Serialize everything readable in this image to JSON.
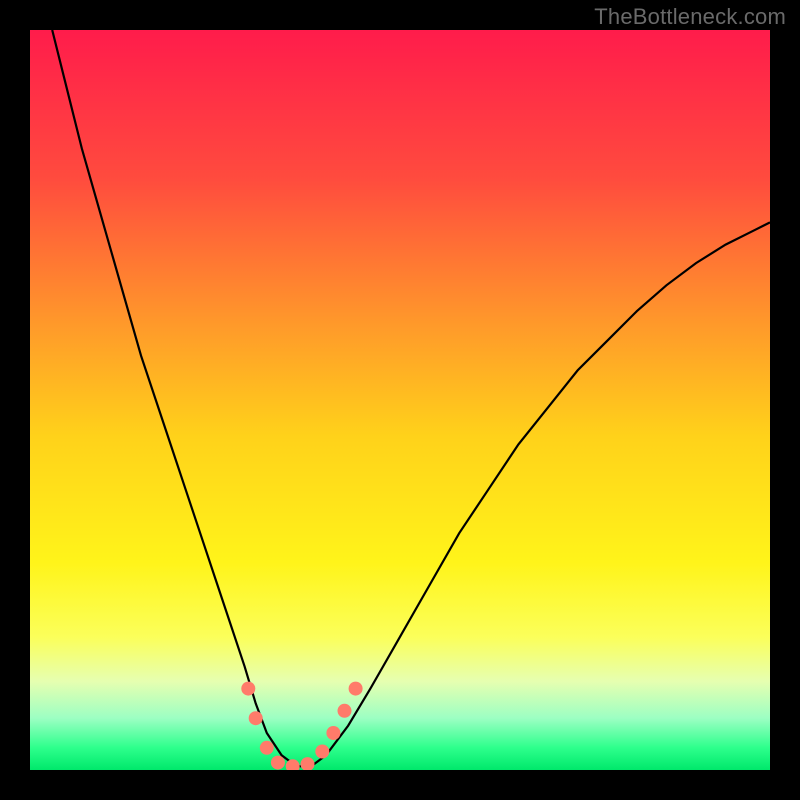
{
  "watermark": "TheBottleneck.com",
  "chart_data": {
    "type": "line",
    "title": "",
    "xlabel": "",
    "ylabel": "",
    "xlim": [
      0,
      100
    ],
    "ylim": [
      0,
      100
    ],
    "grid": false,
    "legend": false,
    "background_gradient": {
      "stops": [
        {
          "pos": 0.0,
          "color": "#ff1c4b"
        },
        {
          "pos": 0.2,
          "color": "#ff4b3e"
        },
        {
          "pos": 0.4,
          "color": "#ff9a2a"
        },
        {
          "pos": 0.55,
          "color": "#ffd21a"
        },
        {
          "pos": 0.72,
          "color": "#fff41a"
        },
        {
          "pos": 0.82,
          "color": "#fbff5a"
        },
        {
          "pos": 0.88,
          "color": "#e6ffb0"
        },
        {
          "pos": 0.93,
          "color": "#9cffc3"
        },
        {
          "pos": 0.97,
          "color": "#2dff8c"
        },
        {
          "pos": 1.0,
          "color": "#00e86b"
        }
      ]
    },
    "series": [
      {
        "name": "bottleneck-curve",
        "color": "#000000",
        "x": [
          3,
          5,
          7,
          9,
          11,
          13,
          15,
          17,
          19,
          21,
          23,
          25,
          27,
          29,
          30.5,
          32,
          34,
          36,
          38,
          40,
          43,
          46,
          50,
          54,
          58,
          62,
          66,
          70,
          74,
          78,
          82,
          86,
          90,
          94,
          98,
          100
        ],
        "y": [
          100,
          92,
          84,
          77,
          70,
          63,
          56,
          50,
          44,
          38,
          32,
          26,
          20,
          14,
          9,
          5,
          2,
          0.5,
          0.5,
          2,
          6,
          11,
          18,
          25,
          32,
          38,
          44,
          49,
          54,
          58,
          62,
          65.5,
          68.5,
          71,
          73,
          74
        ]
      }
    ],
    "markers": {
      "name": "highlight-points",
      "color": "#ff7b6a",
      "radius_px": 7,
      "points": [
        {
          "x": 29.5,
          "y": 11
        },
        {
          "x": 30.5,
          "y": 7
        },
        {
          "x": 32.0,
          "y": 3
        },
        {
          "x": 33.5,
          "y": 1
        },
        {
          "x": 35.5,
          "y": 0.5
        },
        {
          "x": 37.5,
          "y": 0.8
        },
        {
          "x": 39.5,
          "y": 2.5
        },
        {
          "x": 41.0,
          "y": 5
        },
        {
          "x": 42.5,
          "y": 8
        },
        {
          "x": 44.0,
          "y": 11
        }
      ]
    }
  }
}
